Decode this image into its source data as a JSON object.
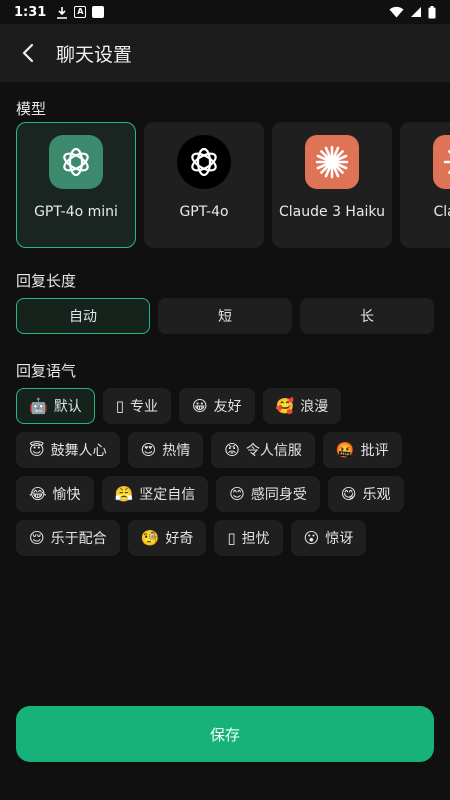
{
  "status": {
    "time": "1:31"
  },
  "header": {
    "title": "聊天设置"
  },
  "sections": {
    "model": "模型",
    "length": "回复长度",
    "tone": "回复语气"
  },
  "models": [
    {
      "name": "GPT-4o mini",
      "logo": "openai-logo",
      "selected": true
    },
    {
      "name": "GPT-4o",
      "logo": "openai-logo",
      "selected": false
    },
    {
      "name": "Claude 3 Haiku",
      "logo": "claude-logo",
      "selected": false
    },
    {
      "name": "Clau So",
      "logo": "claude-logo",
      "selected": false
    }
  ],
  "length": [
    {
      "label": "自动",
      "selected": true
    },
    {
      "label": "短",
      "selected": false
    },
    {
      "label": "长",
      "selected": false
    }
  ],
  "tones": [
    {
      "emoji": "🤖",
      "label": "默认",
      "selected": true
    },
    {
      "emoji": "▯",
      "label": "专业",
      "selected": false
    },
    {
      "emoji": "😀",
      "label": "友好",
      "selected": false
    },
    {
      "emoji": "🥰",
      "label": "浪漫",
      "selected": false
    },
    {
      "emoji": "😇",
      "label": "鼓舞人心",
      "selected": false
    },
    {
      "emoji": "😍",
      "label": "热情",
      "selected": false
    },
    {
      "emoji": "😡",
      "label": "令人信服",
      "selected": false
    },
    {
      "emoji": "🤬",
      "label": "批评",
      "selected": false
    },
    {
      "emoji": "😂",
      "label": "愉快",
      "selected": false
    },
    {
      "emoji": "😤",
      "label": "坚定自信",
      "selected": false
    },
    {
      "emoji": "😊",
      "label": "感同身受",
      "selected": false
    },
    {
      "emoji": "😋",
      "label": "乐观",
      "selected": false
    },
    {
      "emoji": "😌",
      "label": "乐于配合",
      "selected": false
    },
    {
      "emoji": "🧐",
      "label": "好奇",
      "selected": false
    },
    {
      "emoji": "▯",
      "label": "担忧",
      "selected": false
    },
    {
      "emoji": "😮",
      "label": "惊讶",
      "selected": false
    }
  ],
  "save_label": "保存",
  "colors": {
    "accent": "#27b884",
    "save_bg": "#16b27a",
    "card_bg": "#1f1f1f",
    "page_bg": "#101010"
  }
}
